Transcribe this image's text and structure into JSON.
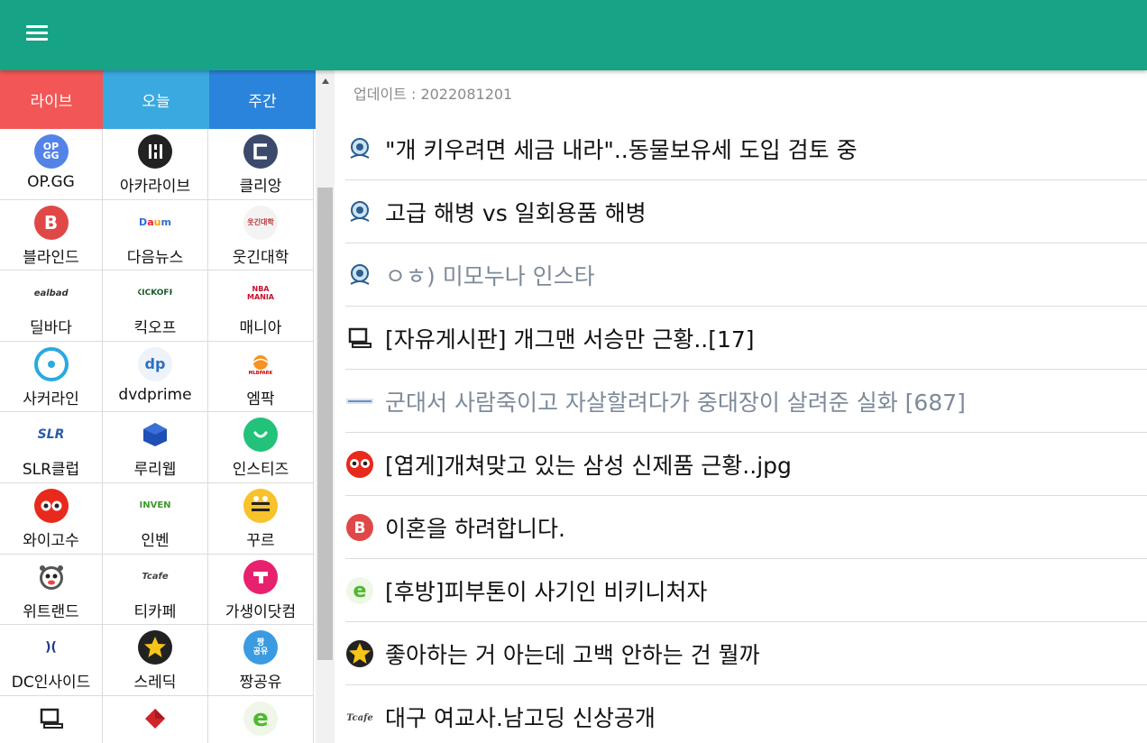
{
  "header": {
    "menu_icon": "hamburger-menu-icon"
  },
  "tabs": [
    {
      "label": "라이브",
      "color": "#f35656"
    },
    {
      "label": "오늘",
      "color": "#3aa9e0"
    },
    {
      "label": "주간",
      "color": "#2b84dc"
    }
  ],
  "sites": [
    {
      "label": "OP.GG",
      "icon": "opgg-logo-icon"
    },
    {
      "label": "아카라이브",
      "icon": "arcalive-logo-icon"
    },
    {
      "label": "클리앙",
      "icon": "clien-logo-icon"
    },
    {
      "label": "블라인드",
      "icon": "blind-logo-icon"
    },
    {
      "label": "다음뉴스",
      "icon": "daum-logo-icon"
    },
    {
      "label": "웃긴대학",
      "icon": "humoruniv-logo-icon"
    },
    {
      "label": "딜바다",
      "icon": "dealbada-logo-icon"
    },
    {
      "label": "킥오프",
      "icon": "kickoff-logo-icon"
    },
    {
      "label": "매니아",
      "icon": "nbamania-logo-icon"
    },
    {
      "label": "사커라인",
      "icon": "soccerline-logo-icon"
    },
    {
      "label": "dvdprime",
      "icon": "dvdprime-logo-icon"
    },
    {
      "label": "엠팍",
      "icon": "mlbpark-logo-icon"
    },
    {
      "label": "SLR클럽",
      "icon": "slrclub-logo-icon"
    },
    {
      "label": "루리웹",
      "icon": "ruliweb-logo-icon"
    },
    {
      "label": "인스티즈",
      "icon": "instiz-logo-icon"
    },
    {
      "label": "와이고수",
      "icon": "ygosu-logo-icon"
    },
    {
      "label": "인벤",
      "icon": "inven-logo-icon"
    },
    {
      "label": "꾸르",
      "icon": "ggoorr-logo-icon"
    },
    {
      "label": "위트랜드",
      "icon": "witland-logo-icon"
    },
    {
      "label": "티카페",
      "icon": "tcafe-logo-icon"
    },
    {
      "label": "가생이닷컴",
      "icon": "gasengi-logo-icon"
    },
    {
      "label": "DC인사이드",
      "icon": "dcinside-logo-icon"
    },
    {
      "label": "스레딕",
      "icon": "threadic-logo-icon"
    },
    {
      "label": "짱공유",
      "icon": "jjang0u-logo-icon"
    },
    {
      "label": "",
      "icon": "pc-logo-icon"
    },
    {
      "label": "",
      "icon": "red-cube-logo-icon"
    },
    {
      "label": "",
      "icon": "etoland-logo-icon"
    }
  ],
  "main": {
    "updated_text": "업데이트 : 2022081201",
    "posts": [
      {
        "title": "\"개 키우려면 세금 내라\"..동물보유세 도입 검토 중",
        "icon": "soccerline-icon",
        "read": false
      },
      {
        "title": "고급 해병 vs 일회용품 해병",
        "icon": "soccerline-icon",
        "read": false
      },
      {
        "title": "ㅇㅎ) 미모누나 인스타",
        "icon": "soccerline-icon",
        "read": true
      },
      {
        "title": "[자유게시판] 개그맨 서승만 근황..[17]",
        "icon": "pc-icon",
        "read": false
      },
      {
        "title": "군대서 사람죽이고 자살할려다가 중대장이 살려준 실화 [687]",
        "icon": "gasengi-text-icon",
        "read": true
      },
      {
        "title": "[엽게]개쳐맞고 있는 삼성 신제품 근황..jpg",
        "icon": "ygosu-icon",
        "read": false
      },
      {
        "title": "이혼을 하려합니다.",
        "icon": "blind-icon",
        "read": false
      },
      {
        "title": "[후방]피부톤이 사기인 비키니처자",
        "icon": "etoland-icon",
        "read": false
      },
      {
        "title": "좋아하는 거 아는데 고백 안하는 건 뭘까",
        "icon": "threadic-icon",
        "read": false
      },
      {
        "title": "대구 여교사.남고딩 신상공개",
        "icon": "tcafe-icon",
        "read": false
      }
    ]
  }
}
